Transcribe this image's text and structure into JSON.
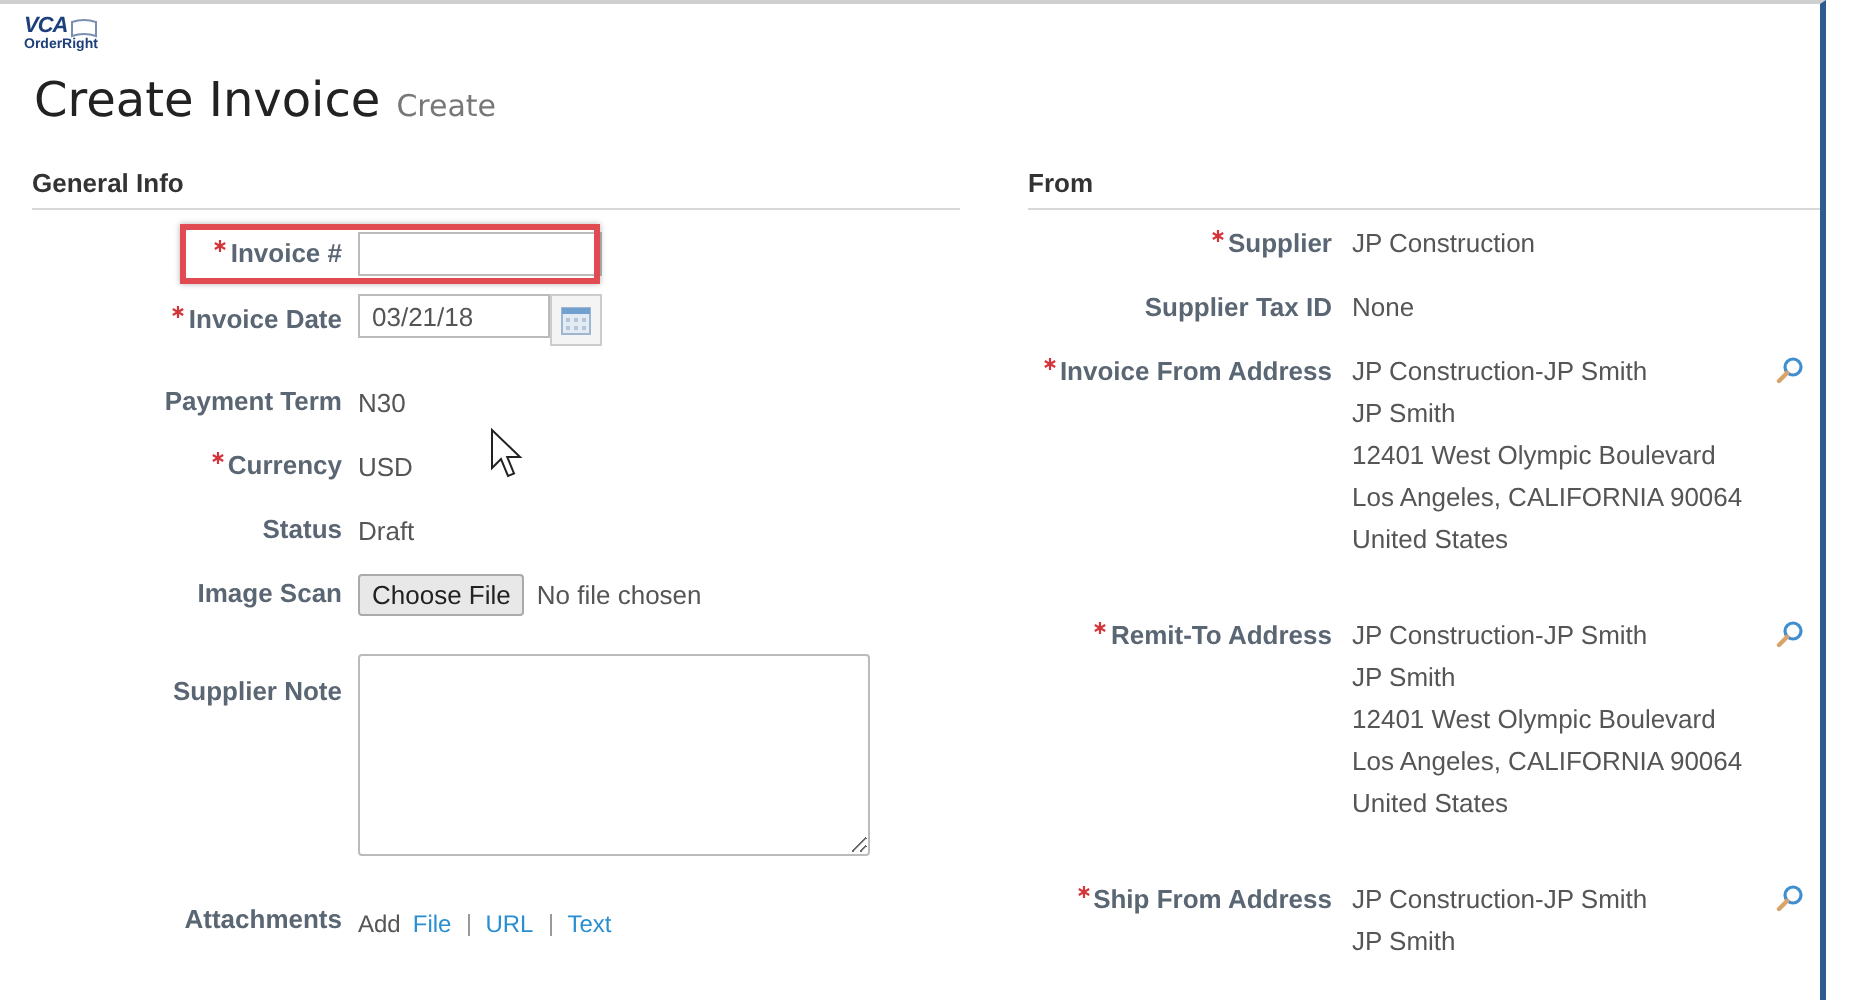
{
  "logo": {
    "brand": "VCA",
    "product": "OrderRight"
  },
  "page": {
    "title": "Create Invoice",
    "subtitle": "Create"
  },
  "general_info": {
    "heading": "General Info",
    "fields": [
      {
        "kind": "input",
        "label": "Invoice #",
        "required": true,
        "highlighted": true
      },
      {
        "kind": "date",
        "label": "Invoice Date",
        "required": true,
        "highlighted": false,
        "value": "03/21/18"
      },
      {
        "kind": "text",
        "label": "Payment Term",
        "required": false,
        "highlighted": false,
        "value": "N30"
      },
      {
        "kind": "text",
        "label": "Currency",
        "required": true,
        "highlighted": false,
        "value": "USD"
      },
      {
        "kind": "text",
        "label": "Status",
        "required": false,
        "highlighted": false,
        "value": "Draft"
      },
      {
        "kind": "file",
        "label": "Image Scan",
        "required": false,
        "highlighted": false,
        "button": "Choose File",
        "value": "No file chosen"
      },
      {
        "kind": "textarea",
        "label": "Supplier Note",
        "required": false,
        "highlighted": false
      },
      {
        "kind": "attachments",
        "label": "Attachments",
        "required": false,
        "highlighted": false,
        "value": "Add",
        "links": [
          "File",
          "URL",
          "Text"
        ]
      }
    ]
  },
  "from": {
    "heading": "From",
    "fields": [
      {
        "kind": "text",
        "label": "Supplier",
        "required": true,
        "value": "JP Construction"
      },
      {
        "kind": "text",
        "label": "Supplier Tax ID",
        "required": false,
        "value": "None"
      },
      {
        "kind": "address",
        "label": "Invoice From Address",
        "required": true,
        "lines": [
          "JP Construction-JP Smith",
          "JP Smith",
          "12401 West Olympic Boulevard",
          "Los Angeles, CALIFORNIA 90064",
          "United States"
        ]
      },
      {
        "kind": "address",
        "label": "Remit-To Address",
        "required": true,
        "lines": [
          "JP Construction-JP Smith",
          "JP Smith",
          "12401 West Olympic Boulevard",
          "Los Angeles, CALIFORNIA 90064",
          "United States"
        ]
      },
      {
        "kind": "address",
        "label": "Ship From Address",
        "required": true,
        "lines": [
          "JP Construction-JP Smith",
          "JP Smith"
        ]
      }
    ]
  }
}
